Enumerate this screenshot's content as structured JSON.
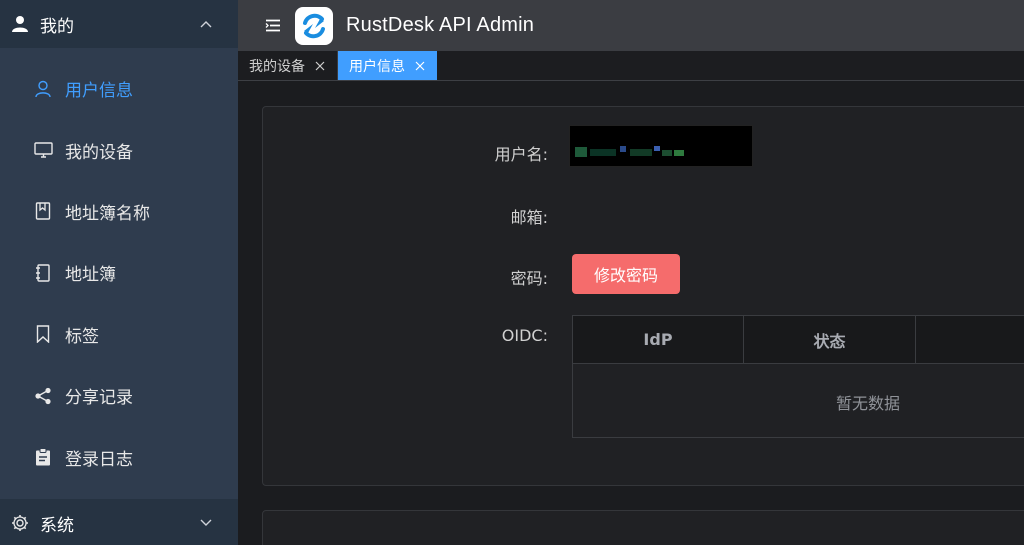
{
  "app": {
    "title": "RustDesk API Admin"
  },
  "sidebar": {
    "groups": [
      {
        "label": "我的",
        "icon": "user-icon",
        "expanded": true,
        "items": [
          {
            "label": "用户信息",
            "icon": "user-outline-icon",
            "active": true
          },
          {
            "label": "我的设备",
            "icon": "monitor-icon",
            "active": false
          },
          {
            "label": "地址簿名称",
            "icon": "book-icon",
            "active": false
          },
          {
            "label": "地址簿",
            "icon": "notebook-icon",
            "active": false
          },
          {
            "label": "标签",
            "icon": "bookmark-icon",
            "active": false
          },
          {
            "label": "分享记录",
            "icon": "share-icon",
            "active": false
          },
          {
            "label": "登录日志",
            "icon": "clipboard-icon",
            "active": false
          }
        ]
      },
      {
        "label": "系统",
        "icon": "gear-icon",
        "expanded": false
      }
    ]
  },
  "tabs": [
    {
      "label": "我的设备",
      "active": false
    },
    {
      "label": "用户信息",
      "active": true
    }
  ],
  "profile": {
    "username_label": "用户名:",
    "username_value": "",
    "email_label": "邮箱:",
    "email_value": "",
    "password_label": "密码:",
    "change_password_label": "修改密码",
    "oidc_label": "OIDC:",
    "oidc_table": {
      "columns": [
        "IdP",
        "状态",
        ""
      ],
      "rows": [],
      "empty_text": "暂无数据"
    }
  },
  "colors": {
    "accent": "#409eff",
    "danger": "#f56c6c",
    "sidebar_bg": "#2f3c4e",
    "topbar_bg": "#3b3d42",
    "content_bg": "#1b1c1f"
  }
}
